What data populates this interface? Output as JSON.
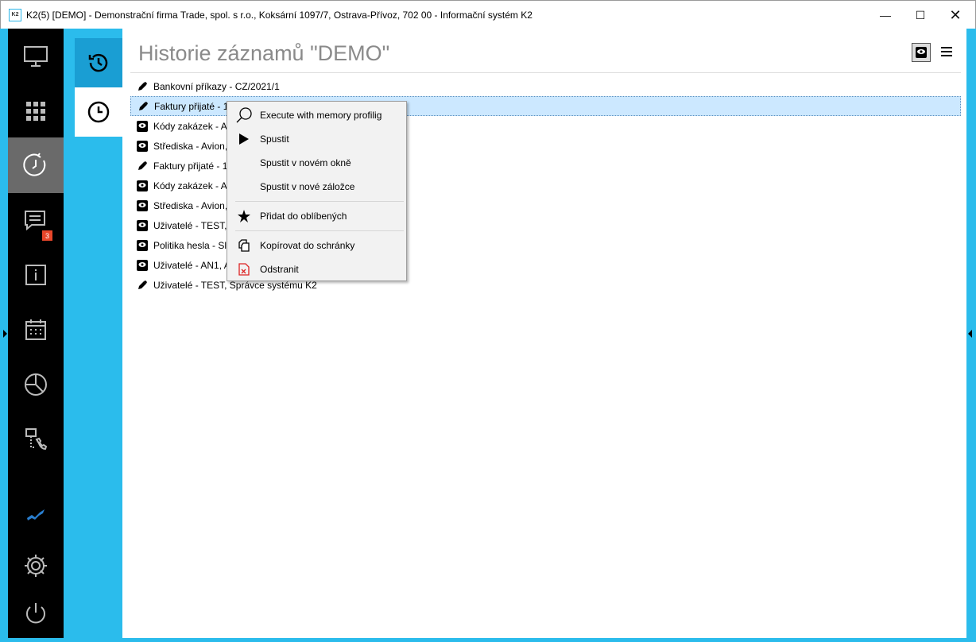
{
  "window": {
    "title": "K2(5) [DEMO] - Demonstrační firma Trade, spol. s r.o., Koksární 1097/7, Ostrava-Přívoz, 702 00 - Informační systém K2",
    "logo": "K2"
  },
  "sidebar": {
    "badge_count": "3",
    "items": [
      "monitor-icon",
      "apps-grid-icon",
      "history-icon",
      "messages-icon",
      "info-icon",
      "calendar-icon",
      "pie-chart-icon",
      "network-phone-icon",
      "k2-logo-icon",
      "gear-icon",
      "power-icon"
    ],
    "active": "history-icon"
  },
  "page": {
    "title": "Historie záznamů \"DEMO\""
  },
  "list": [
    {
      "icon": "pencil",
      "text": "Bankovní příkazy - CZ/2021/1"
    },
    {
      "icon": "pencil",
      "text": "Faktury přijaté - 1",
      "selected": true
    },
    {
      "icon": "view",
      "text": "Kódy zakázek - AB"
    },
    {
      "icon": "view",
      "text": "Střediska - Avion,"
    },
    {
      "icon": "pencil",
      "text": "Faktury přijaté - 1"
    },
    {
      "icon": "view",
      "text": "Kódy zakázek - AB"
    },
    {
      "icon": "view",
      "text": "Střediska - Avion,"
    },
    {
      "icon": "view",
      "text": "Uživatelé - TEST, S"
    },
    {
      "icon": "view",
      "text": "Politika hesla - Sla"
    },
    {
      "icon": "view",
      "text": "Uživatelé - AN1, Ar"
    },
    {
      "icon": "pencil",
      "text": "Uživatelé - TEST, Správce systému K2"
    }
  ],
  "context_menu": {
    "items": [
      {
        "label": "Execute with memory profilig",
        "icon": "magnifier"
      },
      {
        "label": "Spustit",
        "icon": "play"
      },
      {
        "label": "Spustit v novém okně",
        "icon": ""
      },
      {
        "label": "Spustit v nové záložce",
        "icon": ""
      },
      {
        "label": "Přidat do oblíbených",
        "icon": "star"
      },
      {
        "label": "Kopírovat do schránky",
        "icon": "copy"
      },
      {
        "label": "Odstranit",
        "icon": "delete"
      }
    ]
  },
  "colors": {
    "accent": "#2bbcec",
    "sidebar": "#000000",
    "selection": "#cce8ff"
  }
}
